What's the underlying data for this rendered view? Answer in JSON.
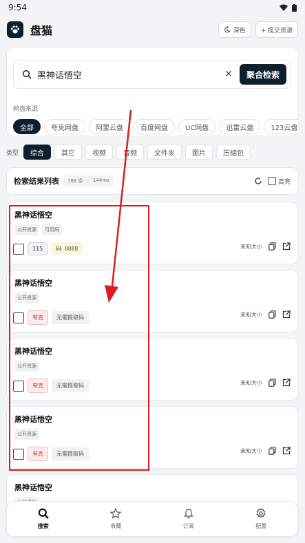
{
  "status_bar": {
    "time": "9:54"
  },
  "app": {
    "title": "盘猫",
    "theme_button": "深色",
    "submit_button": "+ 提交资源"
  },
  "search": {
    "query": "黑神话悟空",
    "submit_label": "聚合检索"
  },
  "sources": {
    "label": "网盘来源",
    "chips": [
      {
        "label": "全部",
        "active": true
      },
      {
        "label": "夸克网盘"
      },
      {
        "label": "阿里云盘"
      },
      {
        "label": "百度网盘"
      },
      {
        "label": "UC网盘"
      },
      {
        "label": "迅雷云盘"
      },
      {
        "label": "123云盘"
      }
    ]
  },
  "types": {
    "label": "类型",
    "chips": [
      {
        "label": "综合",
        "active": true
      },
      {
        "label": "其它"
      },
      {
        "label": "视频"
      },
      {
        "label": "音频"
      },
      {
        "label": "文件夹"
      },
      {
        "label": "图片"
      },
      {
        "label": "压缩包"
      }
    ]
  },
  "results_header": {
    "title": "检索结果列表",
    "count": "188 条",
    "time": "144ms",
    "highlight_label": "高亮"
  },
  "results": [
    {
      "title": "黑神话悟空",
      "tags": [
        "公开资源",
        "可用码"
      ],
      "platform": "115",
      "platform_kind": "default",
      "code": "码 8888",
      "size": "未知大小"
    },
    {
      "title": "黑神话悟空",
      "tags": [
        "公开资源"
      ],
      "platform": "夸克",
      "platform_kind": "quark",
      "code_note": "无需提取码",
      "size": "未知大小"
    },
    {
      "title": "黑神话悟空",
      "tags": [
        "公开资源"
      ],
      "platform": "夸克",
      "platform_kind": "quark",
      "code_note": "无需提取码",
      "size": "未知大小"
    },
    {
      "title": "黑神话悟空",
      "tags": [
        "公开资源"
      ],
      "platform": "夸克",
      "platform_kind": "quark",
      "code_note": "无需提取码",
      "size": "未知大小"
    },
    {
      "title": "黑神话悟空",
      "tags": [
        "公开资源"
      ]
    }
  ],
  "bottom_nav": [
    {
      "label": "搜索",
      "icon": "search-icon",
      "active": true
    },
    {
      "label": "收藏",
      "icon": "star-icon"
    },
    {
      "label": "订阅",
      "icon": "bell-icon"
    },
    {
      "label": "配置",
      "icon": "gear-icon"
    }
  ],
  "colors": {
    "primary": "#0f1e2e",
    "annotation": "#d91e1e",
    "quark": "#c53030"
  }
}
